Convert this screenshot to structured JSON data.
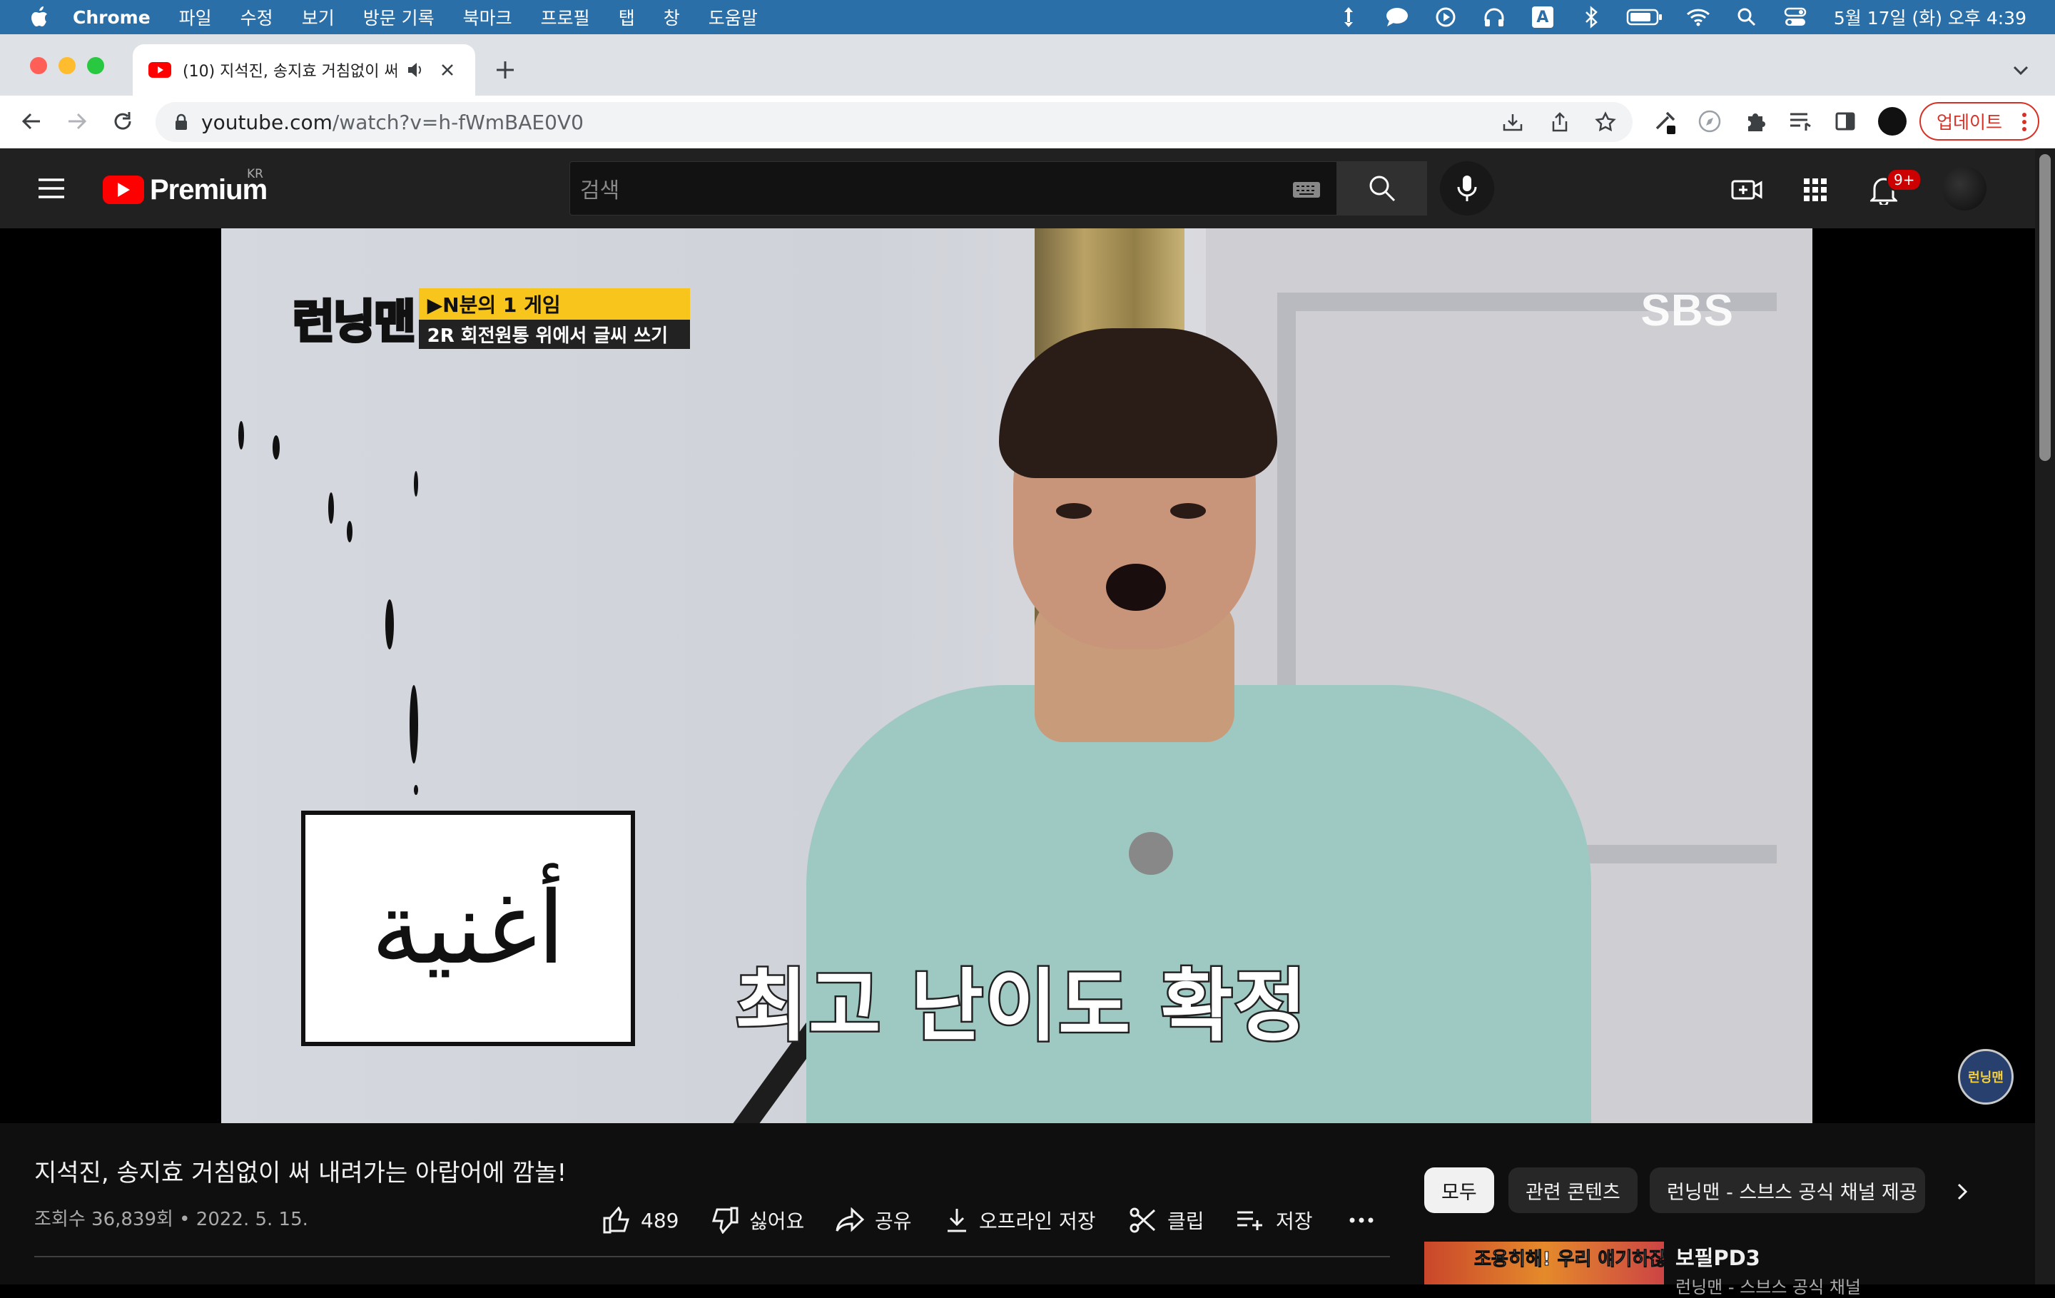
{
  "menubar": {
    "app_name": "Chrome",
    "items": [
      "파일",
      "수정",
      "보기",
      "방문 기록",
      "북마크",
      "프로필",
      "탭",
      "창",
      "도움말"
    ],
    "status_icons": [
      "resize-icon",
      "message-icon",
      "play-icon",
      "headphones-icon",
      "input-a-icon",
      "bluetooth-icon",
      "battery-icon",
      "wifi-icon",
      "spotlight-icon",
      "control-center-icon"
    ],
    "input_letter": "A",
    "clock": "5월 17일 (화) 오후 4:39"
  },
  "browser": {
    "tab_title": "(10) 지석진, 송지효 거침없이 써",
    "address": {
      "host": "youtube.com",
      "path": "/watch?v=h-fWmBAE0V0"
    },
    "update_label": "업데이트"
  },
  "youtube": {
    "logo_text": "Premium",
    "region": "KR",
    "search_placeholder": "검색",
    "notification_count": "9+"
  },
  "video": {
    "show_name": "런닝맨",
    "banner_line1": "▶N분의 1 게임",
    "banner_line2": "2R 회전원통 위에서 글씨 쓰기",
    "broadcaster": "SBS",
    "card_text": "أغنية",
    "subtitle": "최고 난이도 확정",
    "watermark": "런닝맨"
  },
  "info": {
    "title": "지석진, 송지효 거침없이 써 내려가는 아랍어에 깜놀!",
    "meta": "조회수 36,839회 • 2022. 5. 15.",
    "like_count": "489",
    "dislike_label": "싫어요",
    "share_label": "공유",
    "download_label": "오프라인 저장",
    "clip_label": "클립",
    "save_label": "저장"
  },
  "chips": [
    "모두",
    "관련 콘텐츠",
    "런닝맨 - 스브스 공식 채널 제공"
  ],
  "recommended": {
    "thumb_text": "조용히해! 우리 얘기하잖아",
    "title": "보필PD3",
    "channel": "런닝맨 - 스브스 공식 채널"
  },
  "colors": {
    "menubar": "#2b6fa8",
    "youtube_red": "#ff0000",
    "update_red": "#d93025"
  }
}
